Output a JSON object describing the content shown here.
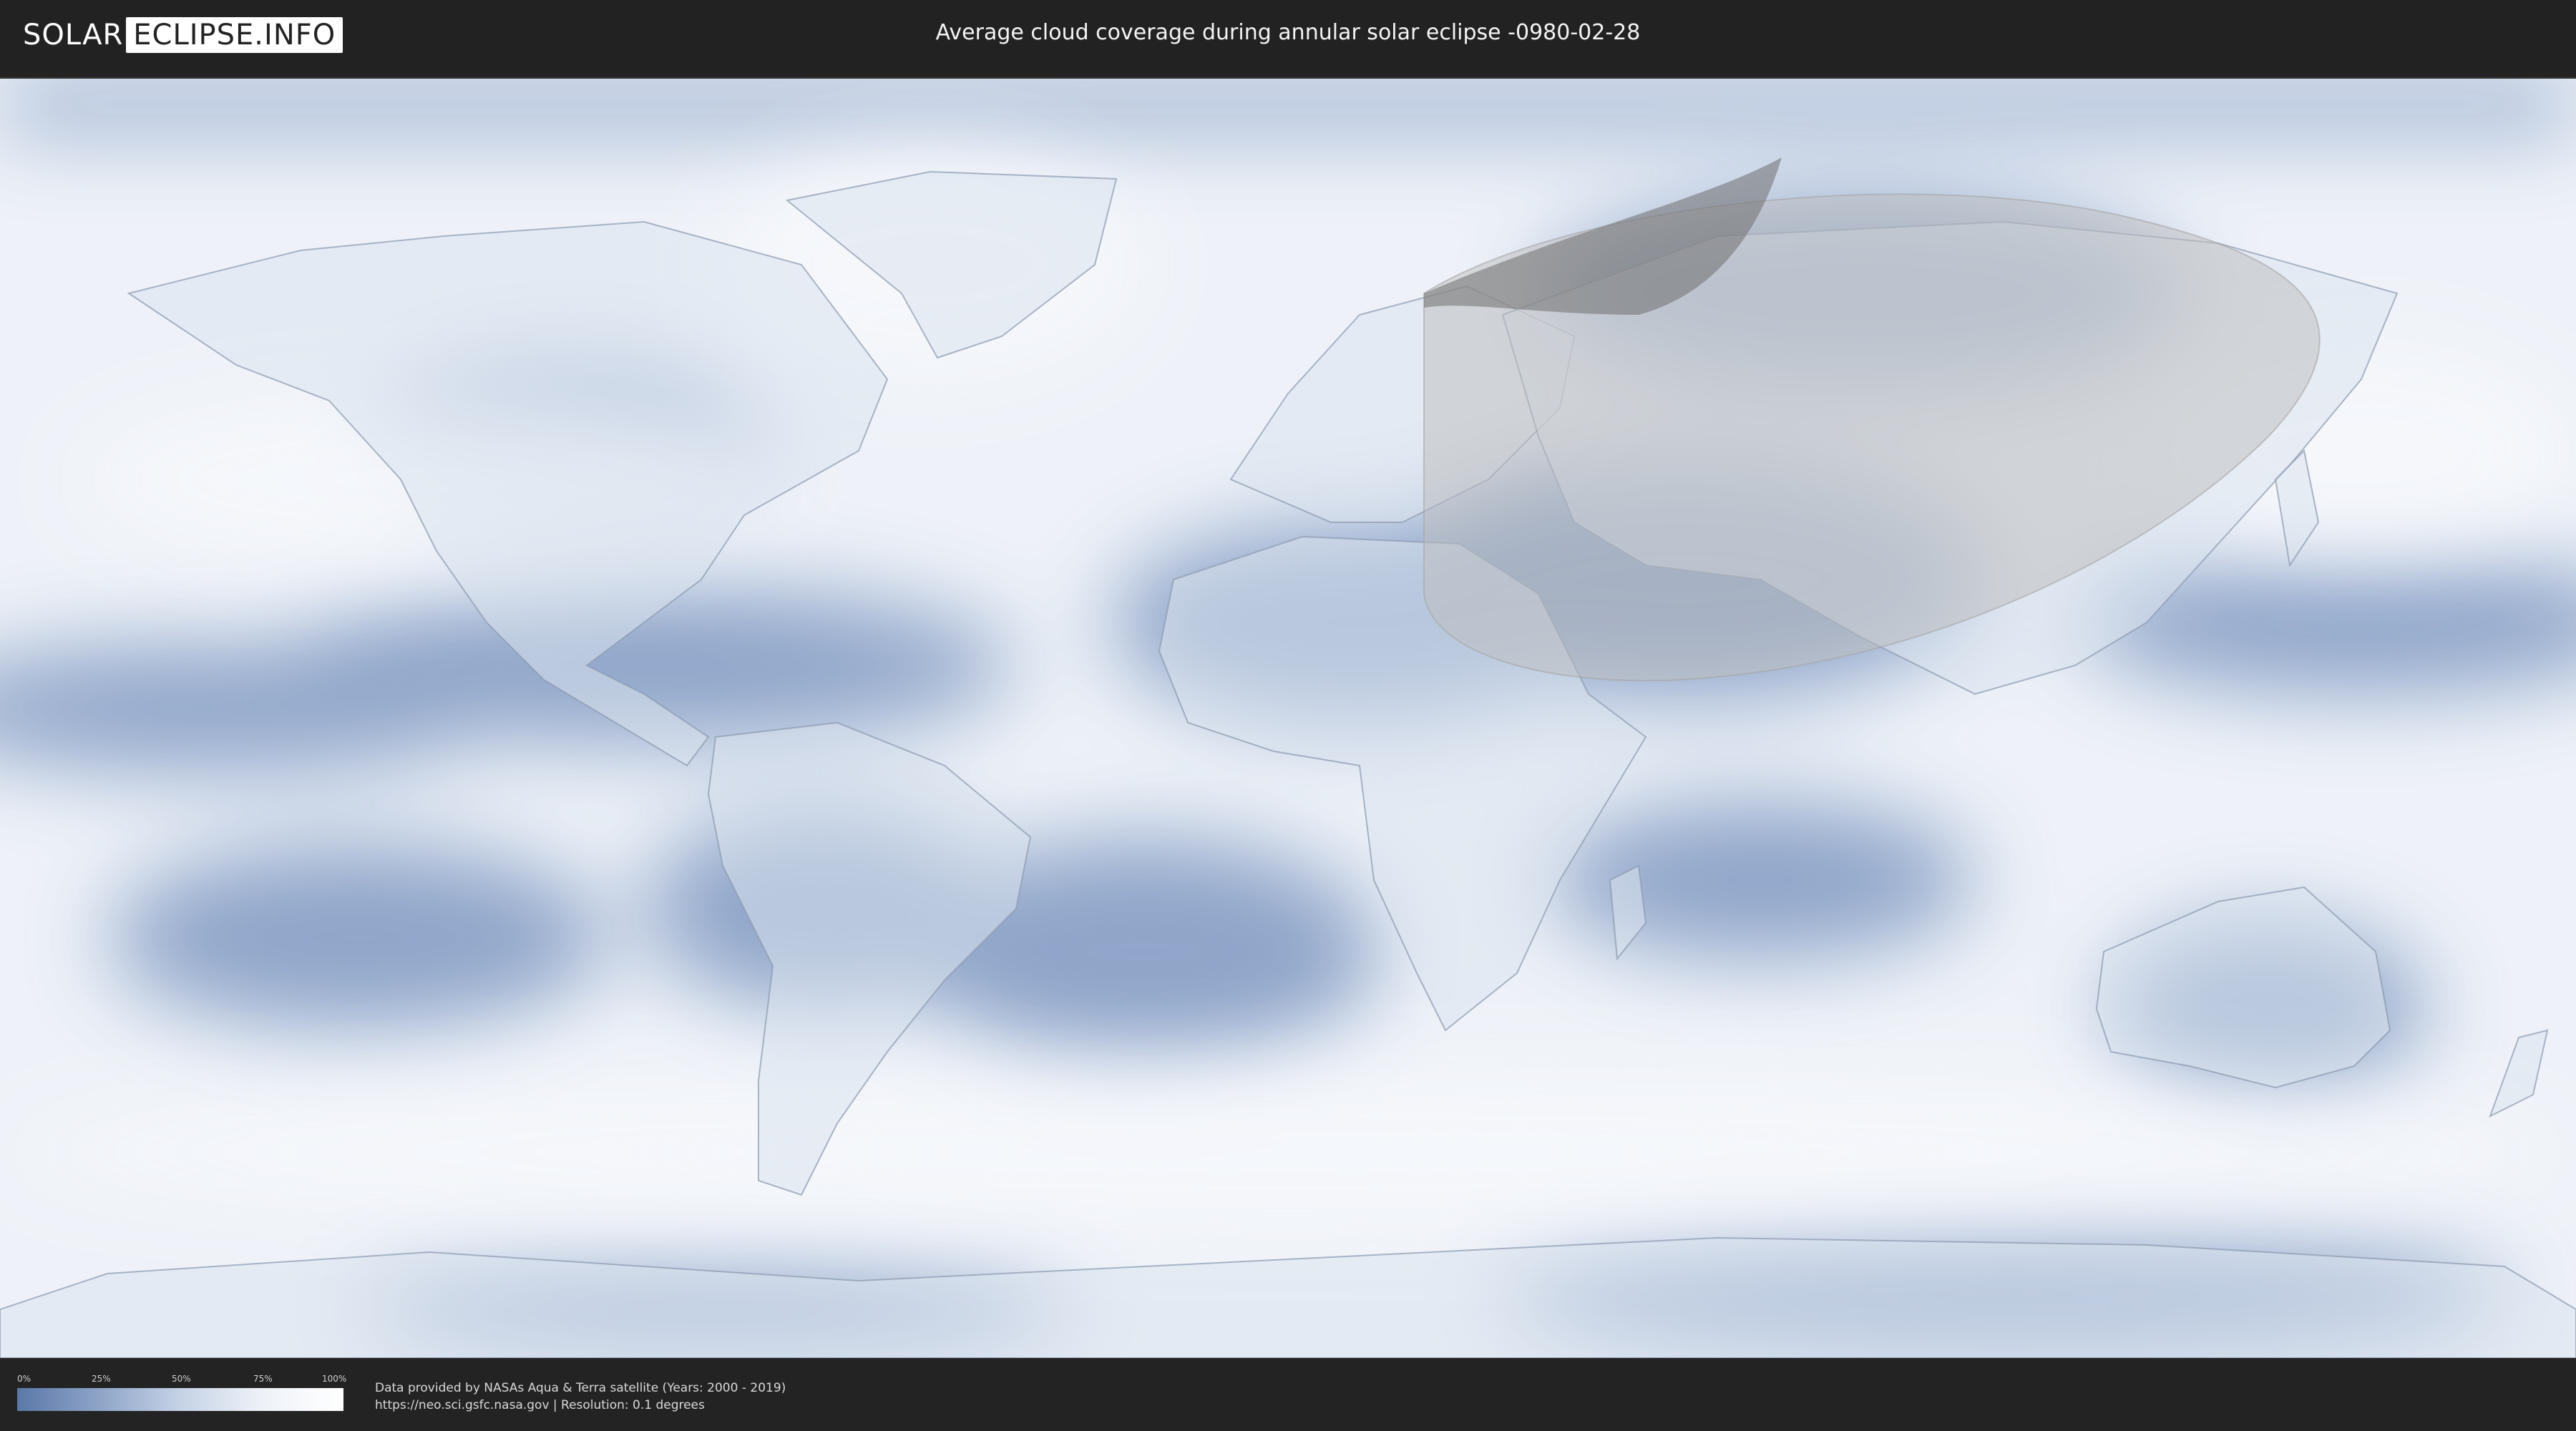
{
  "header": {
    "logo_left": "SOLAR",
    "logo_right": "ECLIPSE.INFO",
    "title": "Average cloud coverage during annular solar eclipse -0980-02-28"
  },
  "legend": {
    "ticks": [
      "0%",
      "25%",
      "50%",
      "75%",
      "100%"
    ],
    "color_low": "#5b78a8",
    "color_high": "#ffffff"
  },
  "credits": {
    "line1": "Data provided by NASAs Aqua & Terra satellite (Years: 2000 - 2019)",
    "line2": "https://neo.sci.gsfc.nasa.gov | Resolution: 0.1 degrees"
  },
  "colors": {
    "ocean_cloudy": "#f2f5fa",
    "clear_sky": "#5f7cac",
    "eclipse_zone": "#bdbdbd",
    "annular_path": "#6f6f6f"
  }
}
